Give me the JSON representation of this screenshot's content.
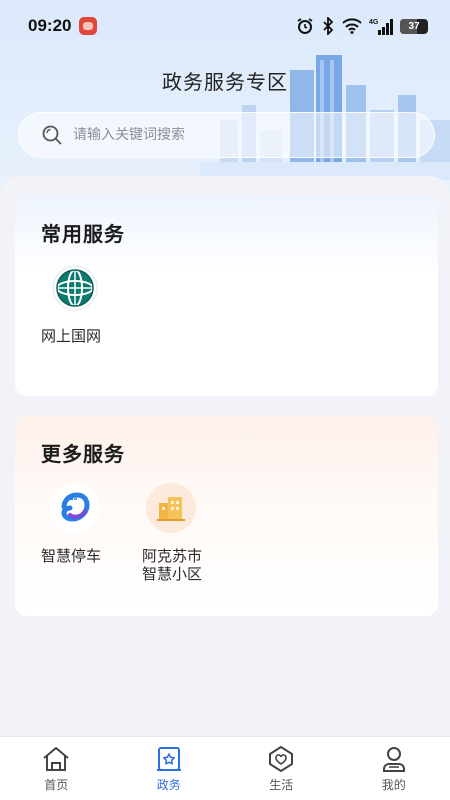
{
  "status_bar": {
    "time": "09:20",
    "network": "4G",
    "battery": "37"
  },
  "header": {
    "title": "政务服务专区"
  },
  "search": {
    "placeholder": "请输入关键词搜索"
  },
  "sections": {
    "common": {
      "title": "常用服务",
      "items": [
        {
          "label": "网上国网",
          "icon": "state-grid-logo-icon"
        }
      ]
    },
    "more": {
      "title": "更多服务",
      "items": [
        {
          "label": "智慧停车",
          "icon": "smart-parking-icon"
        },
        {
          "label_line1": "阿克苏市",
          "label_line2": "智慧小区",
          "icon": "building-icon"
        }
      ]
    }
  },
  "bottom_nav": {
    "items": [
      {
        "label": "首页",
        "icon": "home-icon"
      },
      {
        "label": "政务",
        "icon": "gov-services-icon"
      },
      {
        "label": "生活",
        "icon": "life-icon"
      },
      {
        "label": "我的",
        "icon": "profile-icon"
      }
    ],
    "active_index": 1
  },
  "colors": {
    "accent": "#2c6fe0",
    "header_bg": "#dbe9fb",
    "page_bg": "#eef1f6"
  }
}
